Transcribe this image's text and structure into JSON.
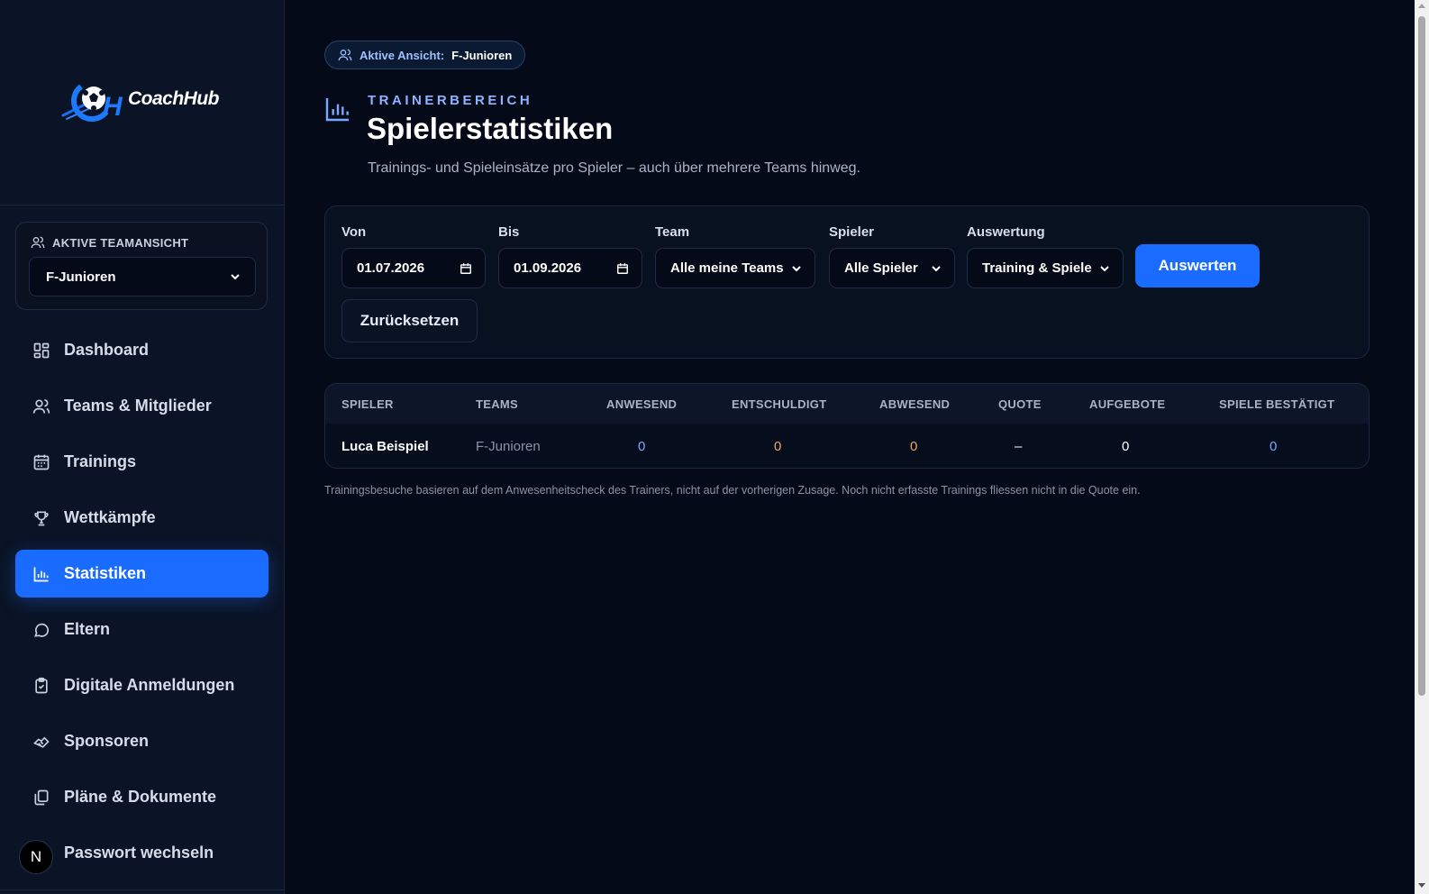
{
  "brand": {
    "name": "CoachHub"
  },
  "sidebar": {
    "team_box": {
      "label": "AKTIVE TEAMANSICHT",
      "selected": "F-Junioren"
    },
    "items": [
      {
        "label": "Dashboard",
        "icon": "grid-icon"
      },
      {
        "label": "Teams & Mitglieder",
        "icon": "users-icon"
      },
      {
        "label": "Trainings",
        "icon": "calendar-icon"
      },
      {
        "label": "Wettkämpfe",
        "icon": "trophy-icon"
      },
      {
        "label": "Statistiken",
        "icon": "bar-chart-icon",
        "active": true
      },
      {
        "label": "Eltern",
        "icon": "chat-icon"
      },
      {
        "label": "Digitale Anmeldungen",
        "icon": "clipboard-check-icon"
      },
      {
        "label": "Sponsoren",
        "icon": "handshake-icon"
      },
      {
        "label": "Pläne & Dokumente",
        "icon": "documents-icon"
      },
      {
        "label": "Passwort wechseln",
        "icon": "key-icon"
      }
    ],
    "avatar_letter": "N"
  },
  "header": {
    "pill_label": "Aktive Ansicht:",
    "pill_value": "F-Junioren",
    "eyebrow": "TRAINERBEREICH",
    "title": "Spielerstatistiken",
    "subtitle": "Trainings- und Spieleinsätze pro Spieler – auch über mehrere Teams hinweg."
  },
  "filters": {
    "von": {
      "label": "Von",
      "value": "01.07.2026"
    },
    "bis": {
      "label": "Bis",
      "value": "01.09.2026"
    },
    "team": {
      "label": "Team",
      "value": "Alle meine Teams"
    },
    "spieler": {
      "label": "Spieler",
      "value": "Alle Spieler"
    },
    "auswertung": {
      "label": "Auswertung",
      "value": "Training & Spiele"
    },
    "submit_label": "Auswerten",
    "reset_label": "Zurücksetzen"
  },
  "table": {
    "headers": [
      "SPIELER",
      "TEAMS",
      "ANWESEND",
      "ENTSCHULDIGT",
      "ABWESEND",
      "QUOTE",
      "AUFGEBOTE",
      "SPIELE BESTÄTIGT"
    ],
    "rows": [
      {
        "spieler": "Luca Beispiel",
        "teams": "F-Junioren",
        "anwesend": "0",
        "entschuldigt": "0",
        "abwesend": "0",
        "quote": "–",
        "aufgebote": "0",
        "spiele_bestaetigt": "0"
      }
    ]
  },
  "footnote": "Trainingsbesuche basieren auf dem Anwesenheitscheck des Trainers, nicht auf der vorherigen Zusage. Noch nicht erfasste Trainings fliessen nicht in die Quote ein.",
  "colors": {
    "accent": "#1a6bff",
    "background": "#050a18",
    "sidebar": "#0b1426",
    "value_blue": "#7aa7ff",
    "value_orange": "#f0a35e"
  }
}
